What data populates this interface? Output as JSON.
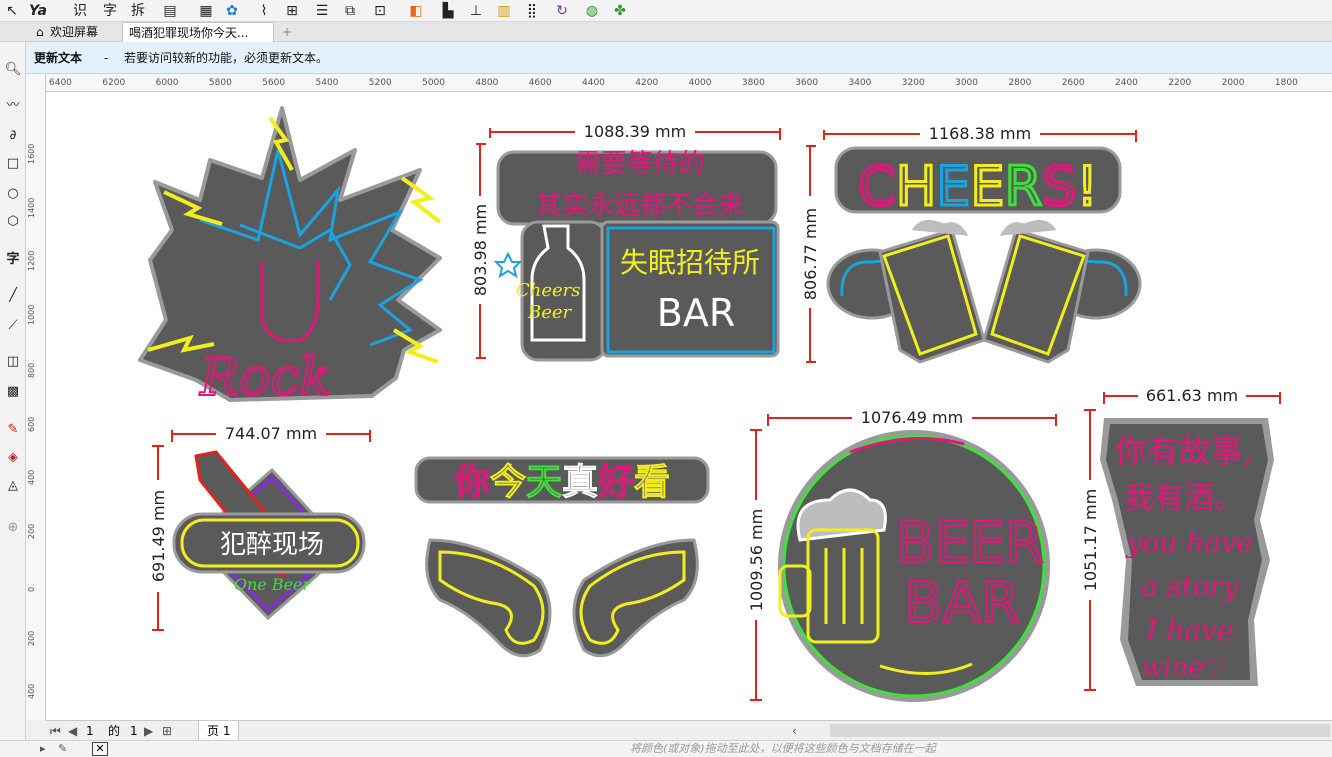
{
  "tabs": [
    {
      "label": "欢迎屏幕"
    },
    {
      "label": "喝酒犯罪现场你今天..."
    }
  ],
  "notice": {
    "title": "更新文本",
    "sep": "-",
    "message": "若要访问较新的功能，必须更新文本。"
  },
  "hruler": [
    "6400",
    "6200",
    "6000",
    "5800",
    "5600",
    "5400",
    "5200",
    "5000",
    "4800",
    "4600",
    "4400",
    "4200",
    "4000",
    "3800",
    "3600",
    "3400",
    "3200",
    "3000",
    "2800",
    "2600",
    "2400",
    "2200",
    "2000",
    "1800"
  ],
  "vruler": [
    "1600",
    "1400",
    "1200",
    "1000",
    "800",
    "600",
    "400",
    "200",
    "0",
    "200",
    "400",
    "600"
  ],
  "dimensions": {
    "rock": "",
    "bar_w": "1088.39 mm",
    "bar_h": "803.98 mm",
    "cheers_w": "1168.38 mm",
    "cheers_h": "806.77 mm",
    "crime_w": "744.07 mm",
    "crime_h": "691.49 mm",
    "beer_w": "1076.49 mm",
    "beer_h": "1009.56 mm",
    "story_w": "661.63 mm",
    "story_h": "1051.17 mm"
  },
  "signs": {
    "rock_text": "Rock",
    "bar_line1": "需要等待的",
    "bar_line2": "其实永远都不会来",
    "bar_cn": "失眠招待所",
    "bar_en": "BAR",
    "bar_script1": "Cheers",
    "bar_script2": "Beer",
    "cheers_text": "CHEERS!",
    "crime_text": "犯醉现场",
    "crime_sub": "One Beer",
    "pretty_text": "你今天真好看",
    "beer_top": "BEER",
    "beer_bottom": "BAR",
    "story_l1": "你有故事,",
    "story_l2": "我有酒。",
    "story_l3": "you have",
    "story_l4": "a story",
    "story_l5": "I have",
    "story_l6": "wine♡"
  },
  "pagenav": {
    "current": "1",
    "of": "的",
    "total": "1",
    "page_tab": "页 1"
  },
  "status": {
    "hint": "将颜色(或对象)拖动至此处，以便将这些颜色与文档存储在一起"
  },
  "colors": {
    "neon_pink": "#e6157d",
    "neon_yellow": "#f2ee1d",
    "neon_blue": "#1aa3df",
    "board": "#5a5a5a",
    "dim": "#e2231a",
    "green": "#3ee13a"
  }
}
